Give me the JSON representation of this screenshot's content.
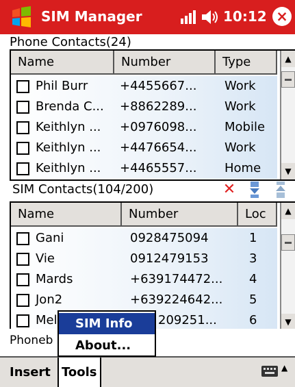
{
  "title_bar": {
    "app_title": "SIM Manager",
    "clock": "10:12",
    "close_symbol": "×"
  },
  "phone": {
    "label": "Phone Contacts(24)",
    "columns": [
      "Name",
      "Number",
      "Type"
    ],
    "rows": [
      {
        "name": "Phil Burr",
        "number": "+4455667...",
        "type": "Work"
      },
      {
        "name": "Brenda C...",
        "number": "+8862289...",
        "type": "Work"
      },
      {
        "name": "Keithlyn ...",
        "number": "+0976098...",
        "type": "Mobile"
      },
      {
        "name": "Keithlyn ...",
        "number": "+4476654...",
        "type": "Work"
      },
      {
        "name": "Keithlyn ...",
        "number": "+4465557...",
        "type": "Home"
      }
    ]
  },
  "sim": {
    "label": "SIM Contacts(104/200)",
    "columns": [
      "Name",
      "Number",
      "Loc"
    ],
    "rows": [
      {
        "name": "Gani",
        "number": "0928475094",
        "loc": "1"
      },
      {
        "name": "Vie",
        "number": "0912479153",
        "loc": "3"
      },
      {
        "name": "Mards",
        "number": "+639174472...",
        "loc": "4"
      },
      {
        "name": "Jon2",
        "number": "+639224642...",
        "loc": "5"
      },
      {
        "name": "Mel",
        "number": "209251...",
        "loc": "6"
      }
    ]
  },
  "phonebook_text": "Phoneb",
  "menu": {
    "insert": "Insert",
    "tools": "Tools"
  },
  "popup": {
    "items": [
      "SIM Info",
      "About..."
    ]
  },
  "icons": {
    "delete": "delete-icon",
    "copy_to_phone": "copy-to-phone-icon",
    "copy_to_sim": "copy-to-sim-icon"
  },
  "colors": {
    "title_bar": "#d81e1e",
    "selection": "#1a3d99"
  }
}
